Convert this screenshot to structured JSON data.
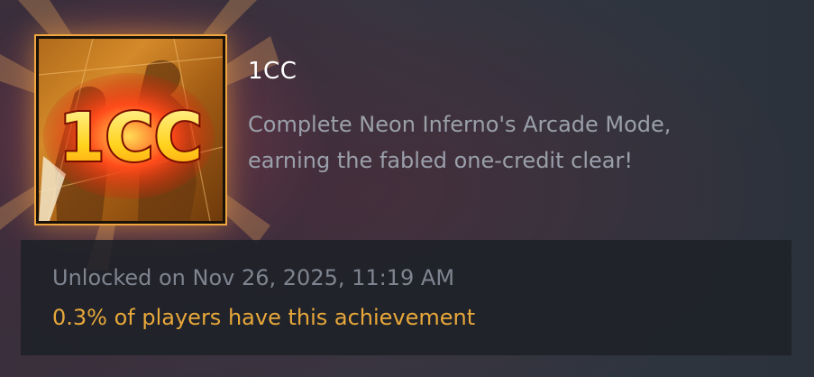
{
  "achievement": {
    "icon_text": "1CC",
    "title": "1CC",
    "description": "Complete Neon Inferno's Arcade Mode, earning the fabled one-credit clear!",
    "unlocked": "Unlocked on Nov 26, 2025, 11:19 AM",
    "rarity": "0.3% of players have this achievement",
    "rarity_color": "#e8a83a",
    "icon": "achievement-1cc-icon"
  }
}
